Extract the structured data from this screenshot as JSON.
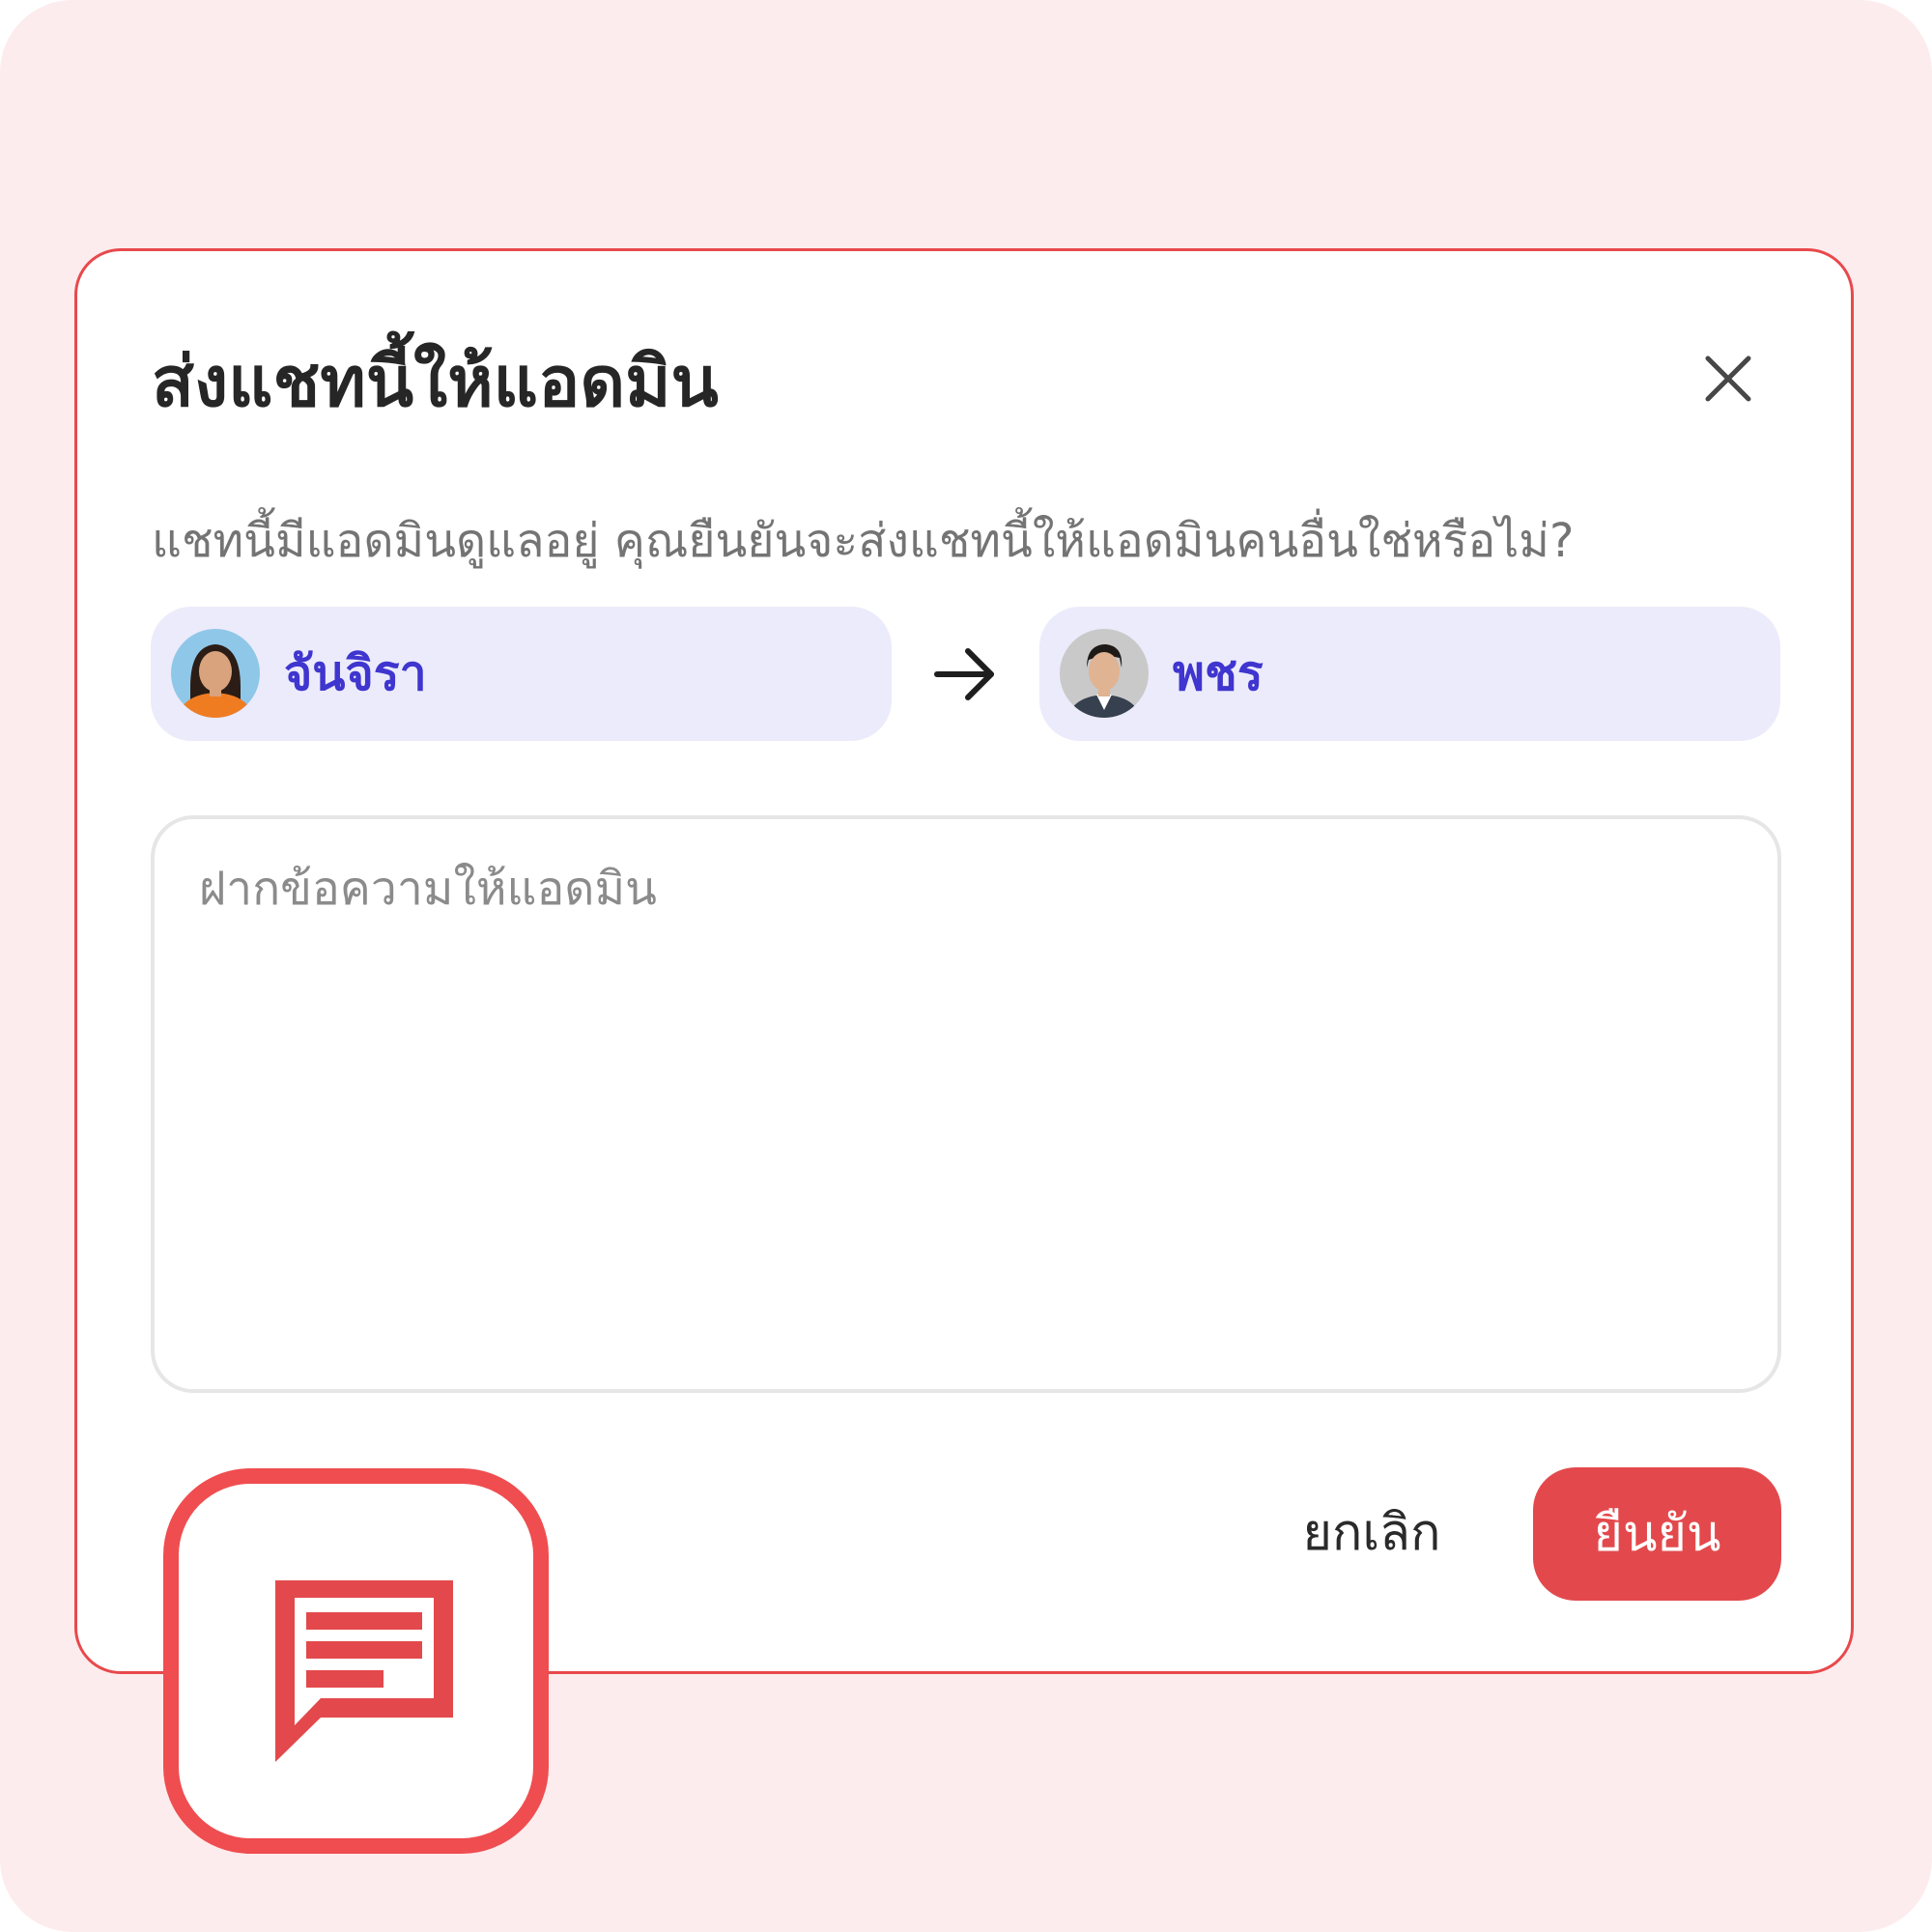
{
  "dialog": {
    "title": "ส่งแชทนี้ให้แอดมิน",
    "message": "แชทนี้มีแอดมินดูแลอยู่ คุณยืนยันจะส่งแชทนี้ให้แอดมินคนอื่นใช่หรือไม่?",
    "close_icon": "close-icon"
  },
  "transfer": {
    "from": {
      "name": "จันจิรา",
      "avatar": "avatar-woman"
    },
    "arrow_icon": "arrow-right-icon",
    "to": {
      "name": "พชร",
      "avatar": "avatar-man"
    }
  },
  "note": {
    "placeholder": "ฝากข้อความให้แอดมิน",
    "value": ""
  },
  "actions": {
    "cancel_label": "ยกเลิก",
    "confirm_label": "ยืนยัน"
  },
  "badge": {
    "icon": "message-icon"
  },
  "colors": {
    "background": "#fdeced",
    "accent": "#e3494c",
    "chip_bg": "#ecebfb",
    "chip_text": "#3f35cf"
  }
}
